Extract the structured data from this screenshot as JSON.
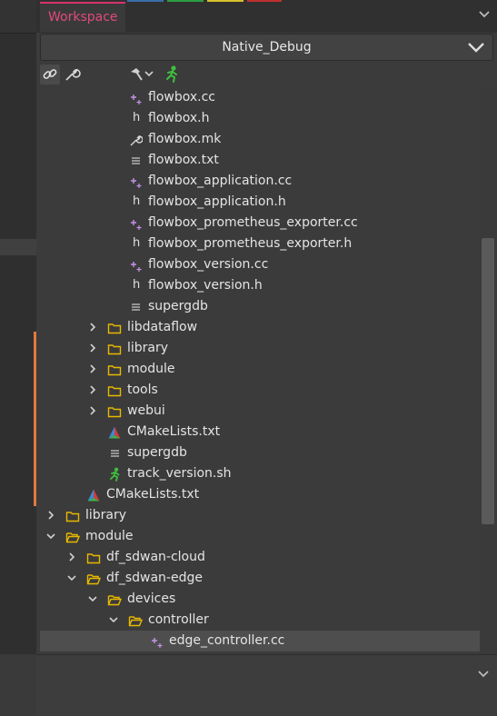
{
  "tab": {
    "label": "Workspace"
  },
  "config": {
    "selected": "Native_Debug"
  },
  "toolbar": {
    "link_icon": "link-icon",
    "settings_icon": "wrench-icon",
    "build_icon": "hammer-icon",
    "run_icon": "run-icon"
  },
  "colors": {
    "tab_accent": "#e0497c",
    "folder": "#e8b800",
    "source_plus": "#c792ea",
    "change_bar": "#e07a3f"
  },
  "tree": [
    {
      "label": "flowbox.cc",
      "icon": "cpp-source-icon",
      "depth": 6,
      "chevron": "none"
    },
    {
      "label": "flowbox.h",
      "icon": "header-icon",
      "depth": 6,
      "chevron": "none"
    },
    {
      "label": "flowbox.mk",
      "icon": "wrench-file-icon",
      "depth": 6,
      "chevron": "none"
    },
    {
      "label": "flowbox.txt",
      "icon": "text-file-icon",
      "depth": 6,
      "chevron": "none"
    },
    {
      "label": "flowbox_application.cc",
      "icon": "cpp-source-icon",
      "depth": 6,
      "chevron": "none"
    },
    {
      "label": "flowbox_application.h",
      "icon": "header-icon",
      "depth": 6,
      "chevron": "none"
    },
    {
      "label": "flowbox_prometheus_exporter.cc",
      "icon": "cpp-source-icon",
      "depth": 6,
      "chevron": "none"
    },
    {
      "label": "flowbox_prometheus_exporter.h",
      "icon": "header-icon",
      "depth": 6,
      "chevron": "none"
    },
    {
      "label": "flowbox_version.cc",
      "icon": "cpp-source-icon",
      "depth": 6,
      "chevron": "none"
    },
    {
      "label": "flowbox_version.h",
      "icon": "header-icon",
      "depth": 6,
      "chevron": "none"
    },
    {
      "label": "supergdb",
      "icon": "text-file-icon",
      "depth": 6,
      "chevron": "none"
    },
    {
      "label": "libdataflow",
      "icon": "folder-icon",
      "depth": 5,
      "chevron": "right"
    },
    {
      "label": "library",
      "icon": "folder-icon",
      "depth": 5,
      "chevron": "right"
    },
    {
      "label": "module",
      "icon": "folder-icon",
      "depth": 5,
      "chevron": "right"
    },
    {
      "label": "tools",
      "icon": "folder-icon",
      "depth": 5,
      "chevron": "right"
    },
    {
      "label": "webui",
      "icon": "folder-icon",
      "depth": 5,
      "chevron": "right"
    },
    {
      "label": "CMakeLists.txt",
      "icon": "cmake-icon",
      "depth": 5,
      "chevron": "none"
    },
    {
      "label": "supergdb",
      "icon": "text-file-icon",
      "depth": 5,
      "chevron": "none"
    },
    {
      "label": "track_version.sh",
      "icon": "run-script-icon",
      "depth": 5,
      "chevron": "none"
    },
    {
      "label": "CMakeLists.txt",
      "icon": "cmake-icon",
      "depth": 4,
      "chevron": "none"
    },
    {
      "label": "library",
      "icon": "folder-icon",
      "depth": 3,
      "chevron": "right"
    },
    {
      "label": "module",
      "icon": "folder-open-icon",
      "depth": 3,
      "chevron": "down"
    },
    {
      "label": "df_sdwan-cloud",
      "icon": "folder-icon",
      "depth": 4,
      "chevron": "right"
    },
    {
      "label": "df_sdwan-edge",
      "icon": "folder-open-icon",
      "depth": 4,
      "chevron": "down"
    },
    {
      "label": "devices",
      "icon": "folder-open-icon",
      "depth": 5,
      "chevron": "down"
    },
    {
      "label": "controller",
      "icon": "folder-open-icon",
      "depth": 6,
      "chevron": "down"
    },
    {
      "label": "edge_controller.cc",
      "icon": "cpp-source-icon",
      "depth": 7,
      "chevron": "none",
      "selected": true
    }
  ]
}
